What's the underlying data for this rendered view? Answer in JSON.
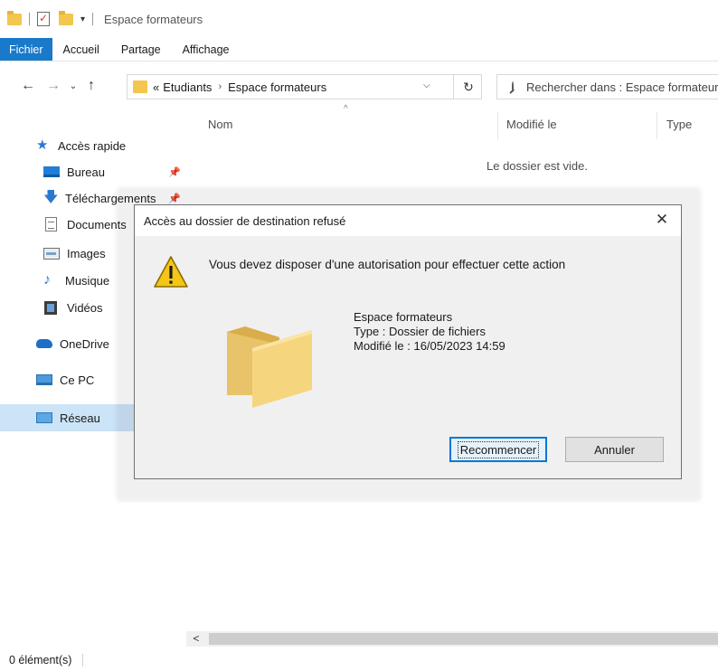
{
  "window": {
    "title": "Espace formateurs"
  },
  "ribbon": {
    "tabs": [
      "Fichier",
      "Accueil",
      "Partage",
      "Affichage"
    ]
  },
  "address": {
    "overflow": "«",
    "parent": "Etudiants",
    "current": "Espace formateurs"
  },
  "search": {
    "placeholder": "Rechercher dans : Espace formateurs"
  },
  "sidebar": {
    "quick_access": "Accès rapide",
    "items": [
      {
        "label": "Bureau",
        "icon": "desktop-icon",
        "pinned": true
      },
      {
        "label": "Téléchargements",
        "icon": "download-icon",
        "pinned": true
      },
      {
        "label": "Documents",
        "icon": "documents-icon",
        "pinned": false
      },
      {
        "label": "Images",
        "icon": "images-icon",
        "pinned": false
      },
      {
        "label": "Musique",
        "icon": "music-icon",
        "pinned": false
      },
      {
        "label": "Vidéos",
        "icon": "videos-icon",
        "pinned": false
      }
    ],
    "onedrive": "OneDrive",
    "this_pc": "Ce PC",
    "network": "Réseau"
  },
  "content": {
    "columns": [
      "Nom",
      "Modifié le",
      "Type"
    ],
    "empty_message": "Le dossier est vide."
  },
  "status": {
    "count": "0 élément(s)"
  },
  "dialog": {
    "title": "Accès au dossier de destination refusé",
    "message": "Vous devez disposer d'une autorisation pour effectuer cette action",
    "item_name": "Espace formateurs",
    "item_type": "Type : Dossier de fichiers",
    "item_modified": "Modifié le : 16/05/2023 14:59",
    "retry_label": "Recommencer",
    "cancel_label": "Annuler"
  },
  "colors": {
    "accent": "#0078d7",
    "file_tab": "#1979ca",
    "selected": "#cce4f7",
    "folder": "#f3c64d",
    "warning": "#f5c518"
  }
}
